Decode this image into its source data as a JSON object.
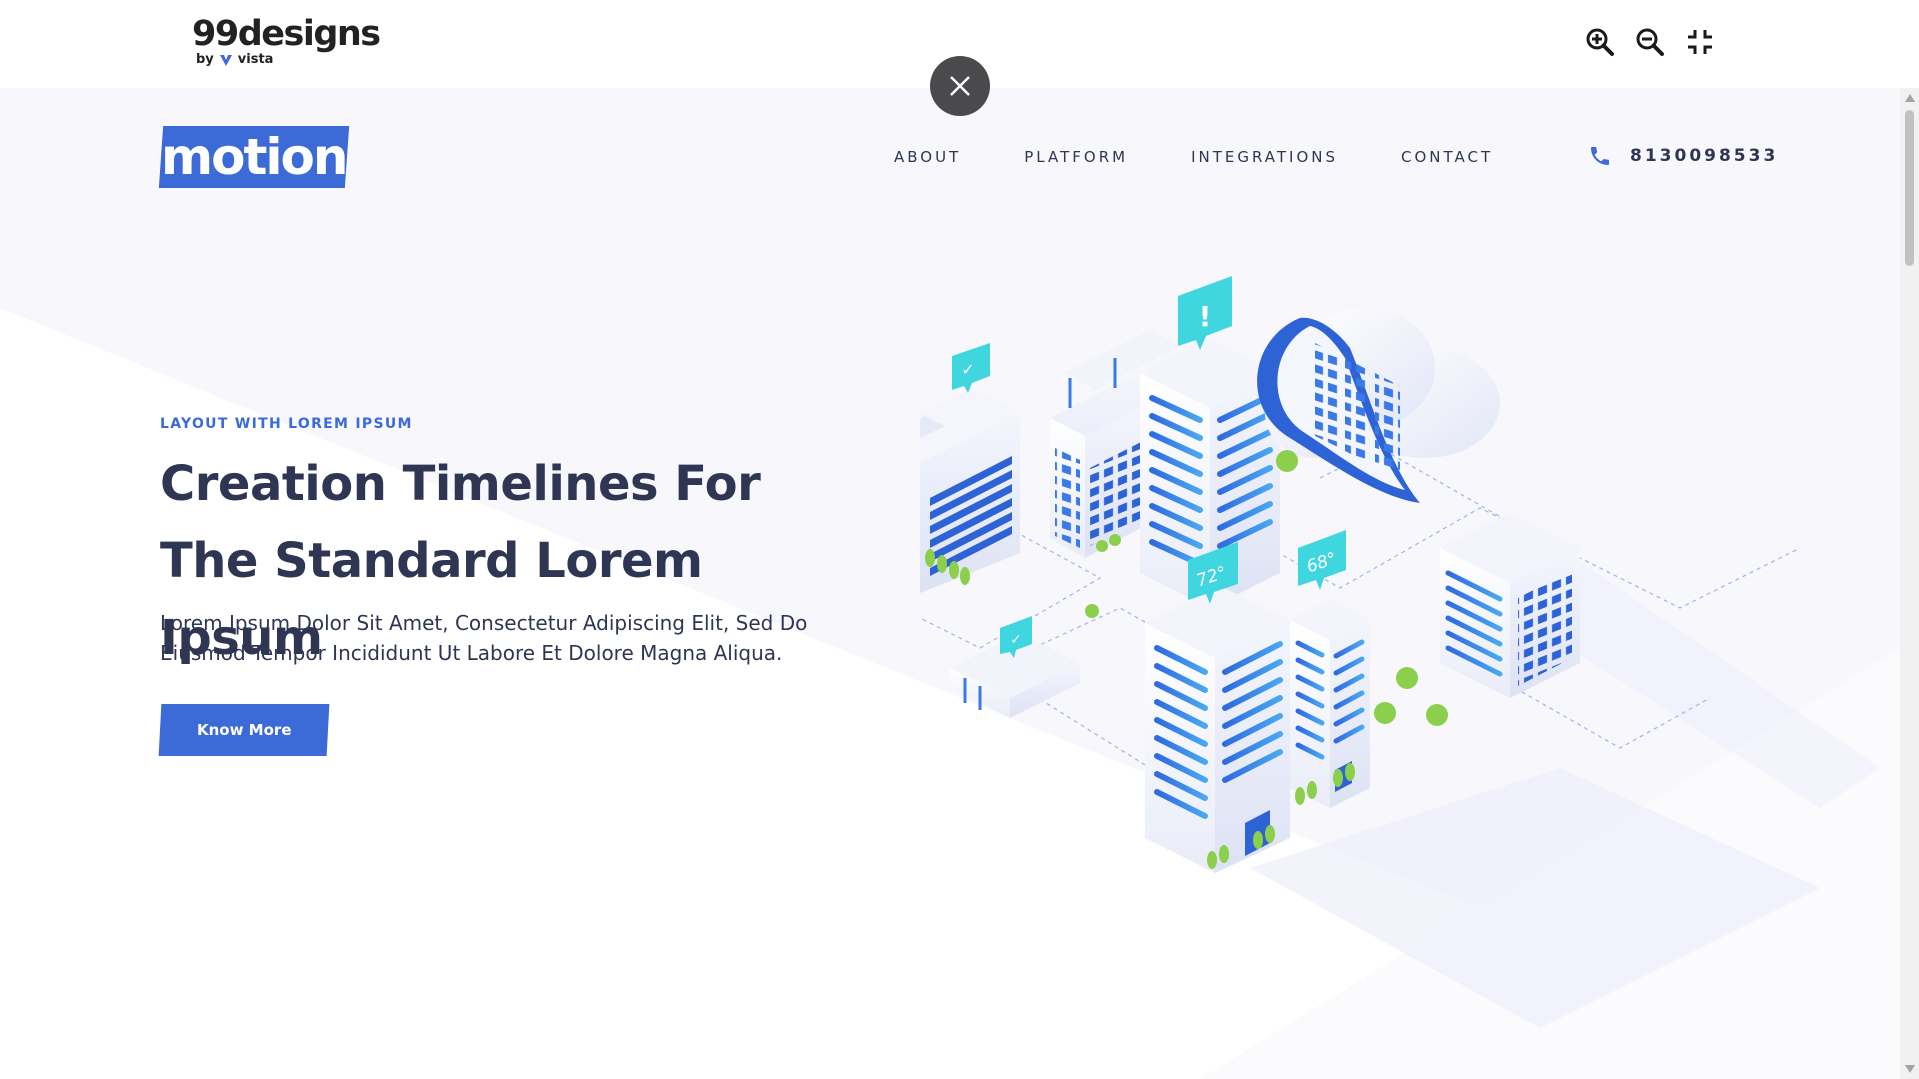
{
  "viewer": {
    "brand_main": "99designs",
    "brand_by": "by",
    "brand_partner": "vista",
    "tools": [
      "zoom-in-icon",
      "zoom-out-icon",
      "fullscreen-exit-icon"
    ],
    "close": "close-icon"
  },
  "site": {
    "logo": "motion",
    "nav": [
      "ABOUT",
      "PLATFORM",
      "INTEGRATIONS",
      "CONTACT"
    ],
    "phone_icon": "phone-icon",
    "phone": "8130098533"
  },
  "hero": {
    "eyebrow": "LAYOUT WITH LOREM IPSUM",
    "title_line1": "Creation Timelines For",
    "title_line2": "The Standard Lorem Ipsum",
    "description_line1": "Lorem Ipsum Dolor Sit Amet, Consectetur Adipiscing Elit, Sed Do",
    "description_line2": "Eiusmod Tempor Incididunt Ut Labore Et Dolore Magna Aliqua.",
    "cta": "Know More"
  },
  "illustration": {
    "badge_temp_1": "72°",
    "badge_temp_2": "68°",
    "badge_alert": "!",
    "badge_check": "✓"
  },
  "colors": {
    "accent": "#3c6bd8",
    "text": "#2f3654",
    "cyan": "#3fd6e0",
    "green": "#8ccf4d"
  }
}
